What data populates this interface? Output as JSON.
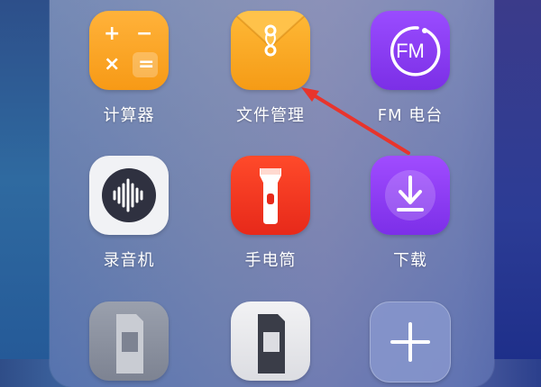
{
  "apps": {
    "calculator": {
      "label": "计算器",
      "icon": "calculator-icon"
    },
    "file_manager": {
      "label": "文件管理",
      "icon": "folder-icon"
    },
    "fm_radio": {
      "label": "FM 电台",
      "icon_text": "FM",
      "icon": "fm-radio-icon"
    },
    "recorder": {
      "label": "录音机",
      "icon": "waveform-icon"
    },
    "flashlight": {
      "label": "手电筒",
      "icon": "flashlight-icon"
    },
    "download": {
      "label": "下载",
      "icon": "download-icon"
    },
    "sim_card_1": {
      "icon": "sim-card-icon"
    },
    "sim_card_2": {
      "icon": "sim-card-icon"
    },
    "add": {
      "icon": "plus-icon"
    }
  },
  "colors": {
    "orange": "#f79a16",
    "purple": "#7b2fe6",
    "red": "#e7291a",
    "annotation_arrow": "#e8342c"
  }
}
